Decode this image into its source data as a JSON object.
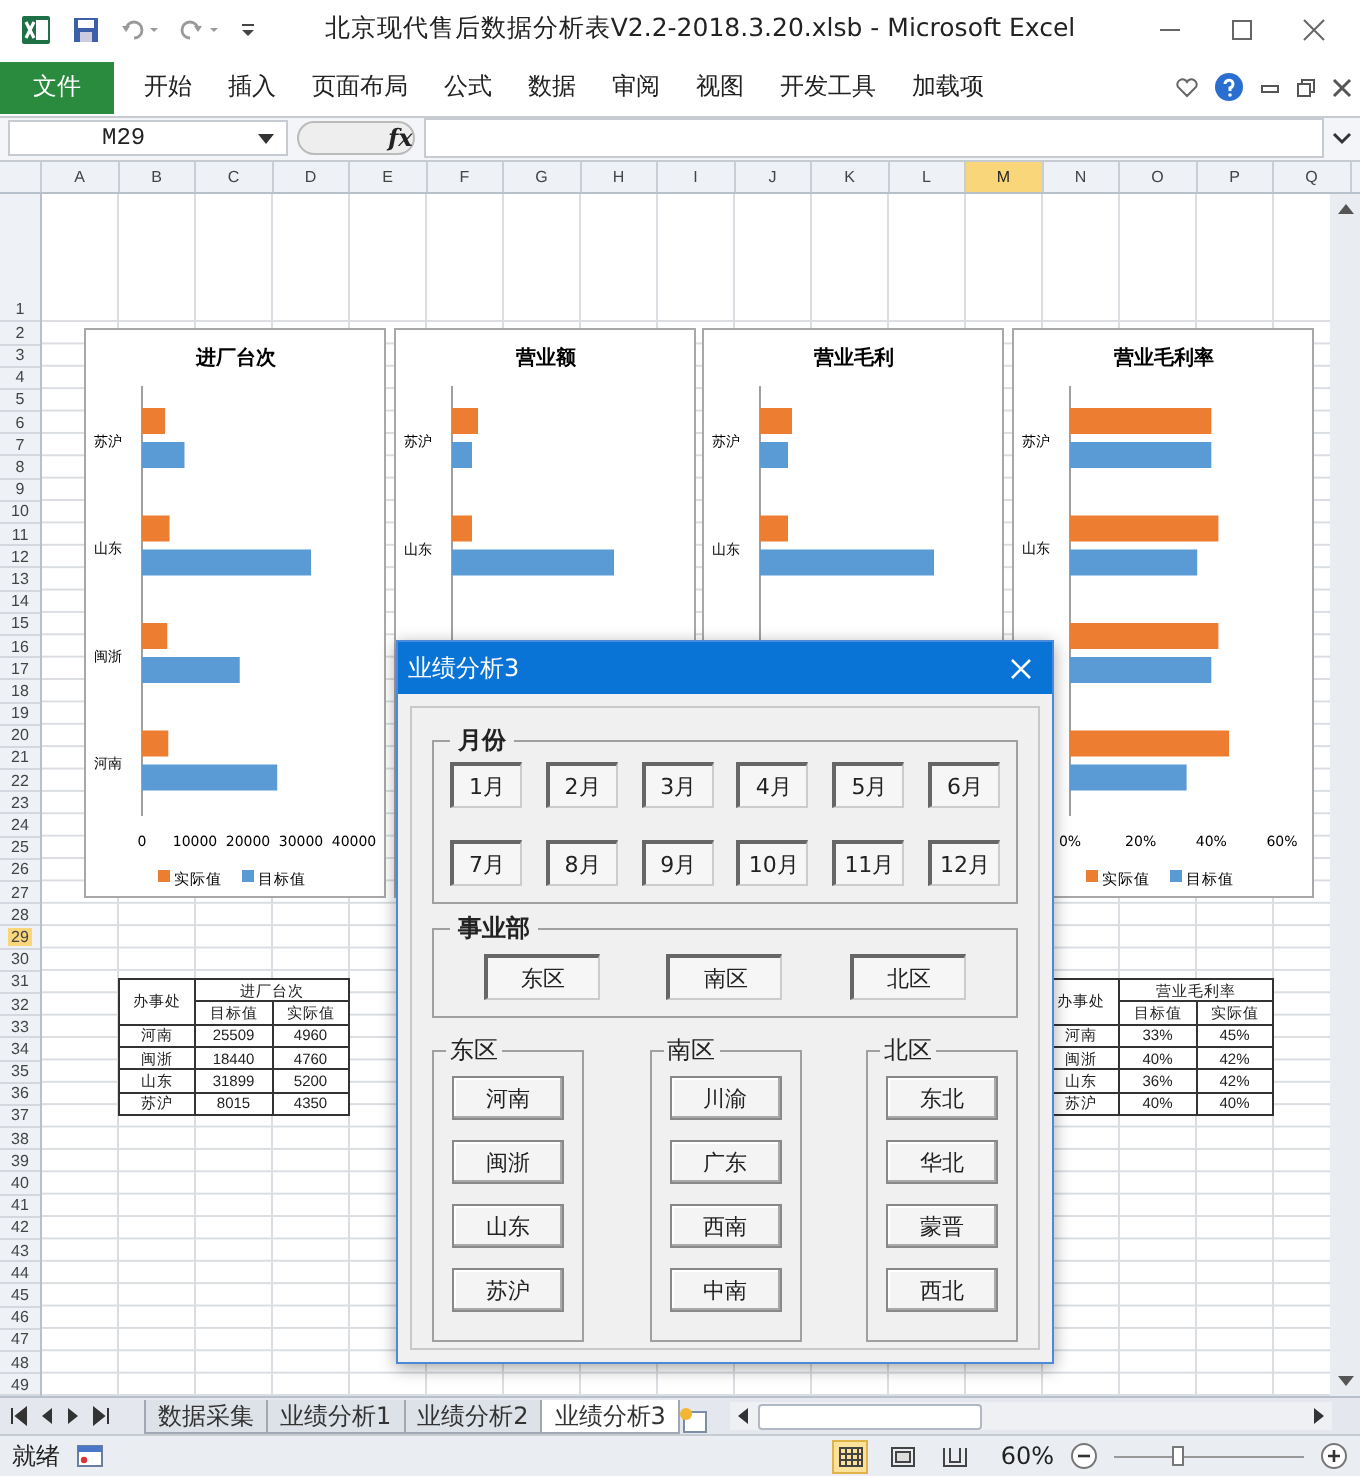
{
  "window": {
    "title": "北京现代售后数据分析表V2.2-2018.3.20.xlsb - Microsoft Excel"
  },
  "file_tab": "文件",
  "ribbon_tabs": [
    "开始",
    "插入",
    "页面布局",
    "公式",
    "数据",
    "审阅",
    "视图",
    "开发工具",
    "加载项"
  ],
  "name_box": {
    "value": "M29"
  },
  "formula_label": "fx",
  "columns": [
    {
      "label": "A",
      "selected": false
    },
    {
      "label": "B",
      "selected": false
    },
    {
      "label": "C",
      "selected": false
    },
    {
      "label": "D",
      "selected": false
    },
    {
      "label": "E",
      "selected": false
    },
    {
      "label": "F",
      "selected": false
    },
    {
      "label": "G",
      "selected": false
    },
    {
      "label": "H",
      "selected": false
    },
    {
      "label": "I",
      "selected": false
    },
    {
      "label": "J",
      "selected": false
    },
    {
      "label": "K",
      "selected": false
    },
    {
      "label": "L",
      "selected": false
    },
    {
      "label": "M",
      "selected": true
    },
    {
      "label": "N",
      "selected": false
    },
    {
      "label": "O",
      "selected": false
    },
    {
      "label": "P",
      "selected": false
    },
    {
      "label": "Q",
      "selected": false
    }
  ],
  "rows": [
    {
      "label": "1",
      "selected": false
    },
    {
      "label": "2",
      "selected": false
    },
    {
      "label": "3",
      "selected": false
    },
    {
      "label": "4",
      "selected": false
    },
    {
      "label": "5",
      "selected": false
    },
    {
      "label": "6",
      "selected": false
    },
    {
      "label": "7",
      "selected": false
    },
    {
      "label": "8",
      "selected": false
    },
    {
      "label": "9",
      "selected": false
    },
    {
      "label": "10",
      "selected": false
    },
    {
      "label": "11",
      "selected": false
    },
    {
      "label": "12",
      "selected": false
    },
    {
      "label": "13",
      "selected": false
    },
    {
      "label": "14",
      "selected": false
    },
    {
      "label": "15",
      "selected": false
    },
    {
      "label": "16",
      "selected": false
    },
    {
      "label": "17",
      "selected": false
    },
    {
      "label": "18",
      "selected": false
    },
    {
      "label": "19",
      "selected": false
    },
    {
      "label": "20",
      "selected": false
    },
    {
      "label": "21",
      "selected": false
    },
    {
      "label": "22",
      "selected": false
    },
    {
      "label": "23",
      "selected": false
    },
    {
      "label": "24",
      "selected": false
    },
    {
      "label": "25",
      "selected": false
    },
    {
      "label": "26",
      "selected": false
    },
    {
      "label": "27",
      "selected": false
    },
    {
      "label": "28",
      "selected": false
    },
    {
      "label": "29",
      "selected": true
    },
    {
      "label": "30",
      "selected": false
    },
    {
      "label": "31",
      "selected": false
    },
    {
      "label": "32",
      "selected": false
    },
    {
      "label": "33",
      "selected": false
    },
    {
      "label": "34",
      "selected": false
    },
    {
      "label": "35",
      "selected": false
    },
    {
      "label": "36",
      "selected": false
    },
    {
      "label": "37",
      "selected": false
    },
    {
      "label": "38",
      "selected": false
    },
    {
      "label": "39",
      "selected": false
    },
    {
      "label": "40",
      "selected": false
    },
    {
      "label": "41",
      "selected": false
    },
    {
      "label": "42",
      "selected": false
    },
    {
      "label": "43",
      "selected": false
    },
    {
      "label": "44",
      "selected": false
    },
    {
      "label": "45",
      "selected": false
    },
    {
      "label": "46",
      "selected": false
    },
    {
      "label": "47",
      "selected": false
    },
    {
      "label": "48",
      "selected": false
    },
    {
      "label": "49",
      "selected": false
    }
  ],
  "charts": [
    {
      "kind": "chart",
      "chart_data": {
        "type": "bar",
        "orientation": "horizontal",
        "title": "进厂台次",
        "legend": "bottom",
        "categories": [
          "苏沪",
          "山东",
          "闽浙",
          "河南"
        ],
        "series": [
          {
            "name": "实际值",
            "color": "#ed7d31",
            "values": [
              4350,
              5200,
              4760,
              4960
            ]
          },
          {
            "name": "目标值",
            "color": "#5b9bd5",
            "values": [
              8015,
              31899,
              18440,
              25509
            ]
          }
        ],
        "xlim": [
          0,
          40000
        ],
        "xticks": [
          0,
          10000,
          20000,
          30000,
          40000
        ]
      }
    },
    {
      "kind": "partial",
      "title": "营业额",
      "category_labels": [
        "苏沪",
        "山东"
      ]
    },
    {
      "kind": "partial",
      "title": "营业毛利",
      "category_labels": [
        "苏沪",
        "山东"
      ]
    },
    {
      "kind": "chart",
      "chart_data": {
        "type": "bar",
        "orientation": "horizontal",
        "title": "营业毛利率",
        "legend": "bottom",
        "categories": [
          "苏沪",
          "山东",
          null,
          null
        ],
        "series": [
          {
            "name": "实际值",
            "color": "#ed7d31",
            "values": [
              0.4,
              0.42,
              0.42,
              0.45
            ]
          },
          {
            "name": "目标值",
            "color": "#5b9bd5",
            "values": [
              0.4,
              0.36,
              0.4,
              0.33
            ]
          }
        ],
        "xlim": [
          0,
          0.6
        ],
        "xticks": [
          {
            "value": 0,
            "label": "0%"
          },
          {
            "value": 0.2,
            "label": "20%"
          },
          {
            "value": 0.4,
            "label": "40%"
          },
          {
            "value": 0.6,
            "label": "60%"
          }
        ]
      }
    }
  ],
  "tables": [
    {
      "corner": "办事处",
      "group": "进厂台次",
      "columns": [
        "目标值",
        "实际值"
      ],
      "rows": [
        {
          "name": "河南",
          "cells": [
            "25509",
            "4960"
          ]
        },
        {
          "name": "闽浙",
          "cells": [
            "18440",
            "4760"
          ]
        },
        {
          "name": "山东",
          "cells": [
            "31899",
            "5200"
          ]
        },
        {
          "name": "苏沪",
          "cells": [
            "8015",
            "4350"
          ]
        }
      ]
    },
    {
      "corner": "办事处",
      "group": "营业毛利率",
      "columns": [
        "目标值",
        "实际值"
      ],
      "rows": [
        {
          "name": "河南",
          "cells": [
            "33%",
            "45%"
          ]
        },
        {
          "name": "闽浙",
          "cells": [
            "40%",
            "42%"
          ]
        },
        {
          "name": "山东",
          "cells": [
            "36%",
            "42%"
          ]
        },
        {
          "name": "苏沪",
          "cells": [
            "40%",
            "40%"
          ]
        }
      ]
    }
  ],
  "dialog": {
    "title": "业绩分析3",
    "month_group": {
      "label": "月份",
      "buttons": [
        "1月",
        "2月",
        "3月",
        "4月",
        "5月",
        "6月",
        "7月",
        "8月",
        "9月",
        "10月",
        "11月",
        "12月"
      ]
    },
    "division_group": {
      "label": "事业部",
      "buttons": [
        "东区",
        "南区",
        "北区"
      ]
    },
    "region_groups": [
      {
        "label": "东区",
        "buttons": [
          "河南",
          "闽浙",
          "山东",
          "苏沪"
        ]
      },
      {
        "label": "南区",
        "buttons": [
          "川渝",
          "广东",
          "西南",
          "中南"
        ]
      },
      {
        "label": "北区",
        "buttons": [
          "东北",
          "华北",
          "蒙晋",
          "西北"
        ]
      }
    ]
  },
  "sheet_tabs": [
    {
      "label": "数据采集",
      "selected": false
    },
    {
      "label": "业绩分析1",
      "selected": false
    },
    {
      "label": "业绩分析2",
      "selected": false
    },
    {
      "label": "业绩分析3",
      "selected": true
    }
  ],
  "status_bar": {
    "status": "就绪",
    "view_buttons": [
      {
        "kind": "normal",
        "selected": true
      },
      {
        "kind": "page-layout",
        "selected": false
      },
      {
        "kind": "page-break",
        "selected": false
      }
    ],
    "zoom": "60%",
    "zoom_slider": {
      "level": 0.34
    }
  }
}
